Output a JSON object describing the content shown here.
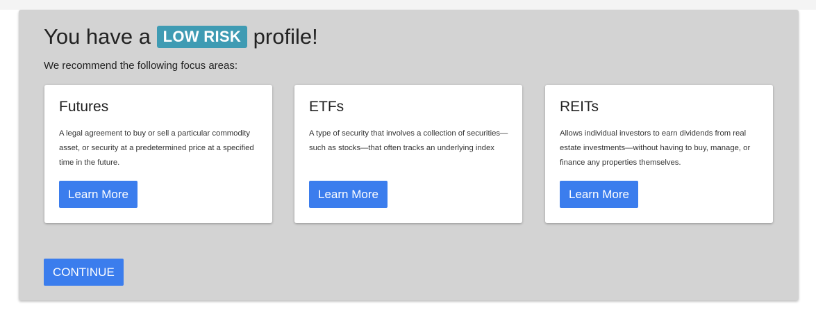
{
  "header": {
    "title_prefix": "You have a",
    "risk_level": "LOW RISK",
    "title_suffix": "profile!",
    "subtitle": "We recommend the following focus areas:"
  },
  "colors": {
    "panel_background": "#d3d3d3",
    "risk_badge": "#3f9bb3",
    "button": "#3b7ded"
  },
  "cards": [
    {
      "title": "Futures",
      "description": "A legal agreement to buy or sell a particular commodity asset, or security at a predetermined price at a specified time in the future.",
      "button_label": "Learn More"
    },
    {
      "title": "ETFs",
      "description": "A type of security that involves a collection of securities—such as stocks—that often tracks an underlying index",
      "button_label": "Learn More"
    },
    {
      "title": "REITs",
      "description": "Allows individual investors to earn dividends from real estate investments—without having to buy, manage, or finance any properties themselves.",
      "button_label": "Learn More"
    }
  ],
  "footer": {
    "continue_label": "CONTINUE"
  }
}
